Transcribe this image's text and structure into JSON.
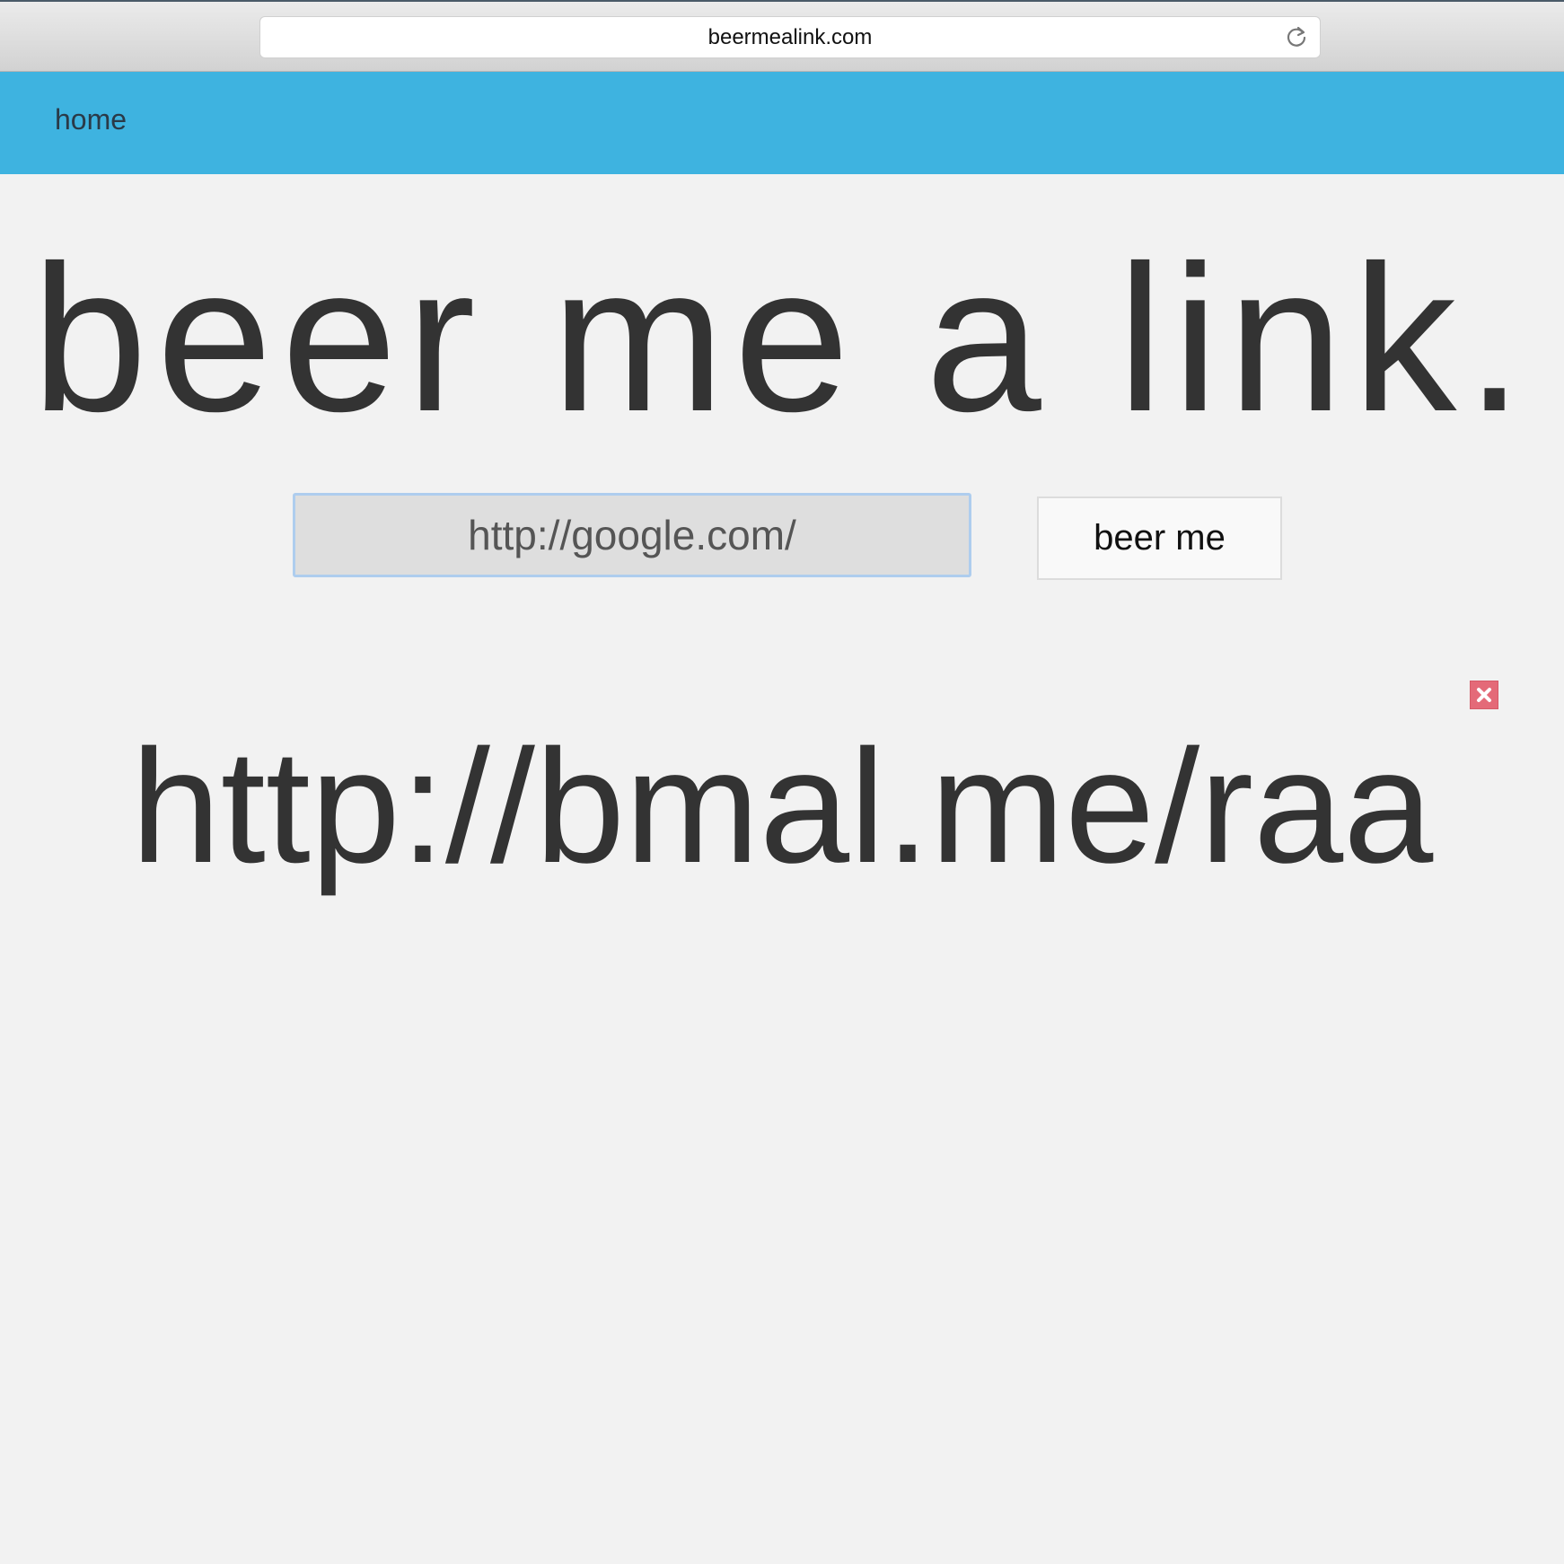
{
  "browser": {
    "address": "beermealink.com",
    "reload_icon": "reload-icon"
  },
  "navbar": {
    "home_label": "home",
    "color": "#3eb3e0"
  },
  "main": {
    "title": "beer me a link.",
    "url_input_value": "http://google.com/",
    "submit_label": "beer me",
    "close_icon": "close-icon",
    "close_color": "#e46a78",
    "result_link": "http://bmal.me/raa"
  }
}
